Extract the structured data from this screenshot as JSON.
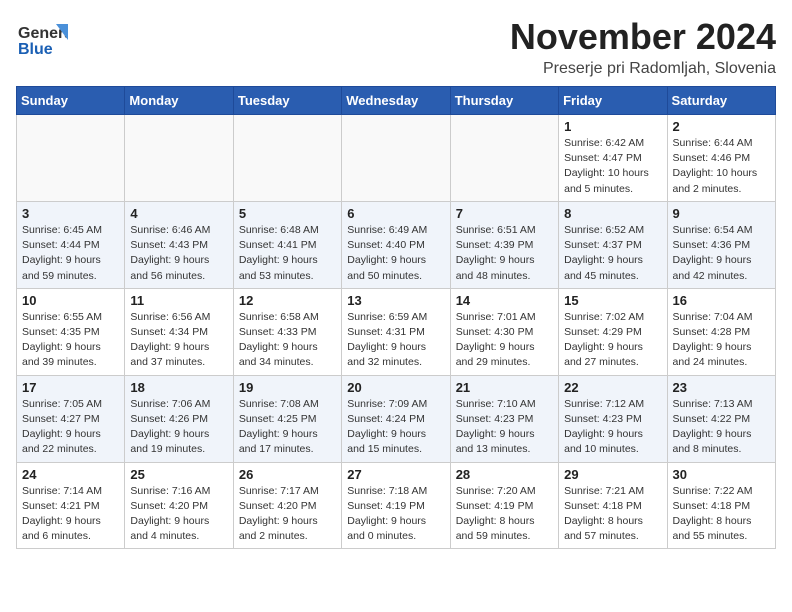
{
  "header": {
    "logo_general": "General",
    "logo_blue": "Blue",
    "month_title": "November 2024",
    "subtitle": "Preserje pri Radomljah, Slovenia"
  },
  "weekdays": [
    "Sunday",
    "Monday",
    "Tuesday",
    "Wednesday",
    "Thursday",
    "Friday",
    "Saturday"
  ],
  "weeks": [
    [
      {
        "day": "",
        "info": ""
      },
      {
        "day": "",
        "info": ""
      },
      {
        "day": "",
        "info": ""
      },
      {
        "day": "",
        "info": ""
      },
      {
        "day": "",
        "info": ""
      },
      {
        "day": "1",
        "info": "Sunrise: 6:42 AM\nSunset: 4:47 PM\nDaylight: 10 hours\nand 5 minutes."
      },
      {
        "day": "2",
        "info": "Sunrise: 6:44 AM\nSunset: 4:46 PM\nDaylight: 10 hours\nand 2 minutes."
      }
    ],
    [
      {
        "day": "3",
        "info": "Sunrise: 6:45 AM\nSunset: 4:44 PM\nDaylight: 9 hours\nand 59 minutes."
      },
      {
        "day": "4",
        "info": "Sunrise: 6:46 AM\nSunset: 4:43 PM\nDaylight: 9 hours\nand 56 minutes."
      },
      {
        "day": "5",
        "info": "Sunrise: 6:48 AM\nSunset: 4:41 PM\nDaylight: 9 hours\nand 53 minutes."
      },
      {
        "day": "6",
        "info": "Sunrise: 6:49 AM\nSunset: 4:40 PM\nDaylight: 9 hours\nand 50 minutes."
      },
      {
        "day": "7",
        "info": "Sunrise: 6:51 AM\nSunset: 4:39 PM\nDaylight: 9 hours\nand 48 minutes."
      },
      {
        "day": "8",
        "info": "Sunrise: 6:52 AM\nSunset: 4:37 PM\nDaylight: 9 hours\nand 45 minutes."
      },
      {
        "day": "9",
        "info": "Sunrise: 6:54 AM\nSunset: 4:36 PM\nDaylight: 9 hours\nand 42 minutes."
      }
    ],
    [
      {
        "day": "10",
        "info": "Sunrise: 6:55 AM\nSunset: 4:35 PM\nDaylight: 9 hours\nand 39 minutes."
      },
      {
        "day": "11",
        "info": "Sunrise: 6:56 AM\nSunset: 4:34 PM\nDaylight: 9 hours\nand 37 minutes."
      },
      {
        "day": "12",
        "info": "Sunrise: 6:58 AM\nSunset: 4:33 PM\nDaylight: 9 hours\nand 34 minutes."
      },
      {
        "day": "13",
        "info": "Sunrise: 6:59 AM\nSunset: 4:31 PM\nDaylight: 9 hours\nand 32 minutes."
      },
      {
        "day": "14",
        "info": "Sunrise: 7:01 AM\nSunset: 4:30 PM\nDaylight: 9 hours\nand 29 minutes."
      },
      {
        "day": "15",
        "info": "Sunrise: 7:02 AM\nSunset: 4:29 PM\nDaylight: 9 hours\nand 27 minutes."
      },
      {
        "day": "16",
        "info": "Sunrise: 7:04 AM\nSunset: 4:28 PM\nDaylight: 9 hours\nand 24 minutes."
      }
    ],
    [
      {
        "day": "17",
        "info": "Sunrise: 7:05 AM\nSunset: 4:27 PM\nDaylight: 9 hours\nand 22 minutes."
      },
      {
        "day": "18",
        "info": "Sunrise: 7:06 AM\nSunset: 4:26 PM\nDaylight: 9 hours\nand 19 minutes."
      },
      {
        "day": "19",
        "info": "Sunrise: 7:08 AM\nSunset: 4:25 PM\nDaylight: 9 hours\nand 17 minutes."
      },
      {
        "day": "20",
        "info": "Sunrise: 7:09 AM\nSunset: 4:24 PM\nDaylight: 9 hours\nand 15 minutes."
      },
      {
        "day": "21",
        "info": "Sunrise: 7:10 AM\nSunset: 4:23 PM\nDaylight: 9 hours\nand 13 minutes."
      },
      {
        "day": "22",
        "info": "Sunrise: 7:12 AM\nSunset: 4:23 PM\nDaylight: 9 hours\nand 10 minutes."
      },
      {
        "day": "23",
        "info": "Sunrise: 7:13 AM\nSunset: 4:22 PM\nDaylight: 9 hours\nand 8 minutes."
      }
    ],
    [
      {
        "day": "24",
        "info": "Sunrise: 7:14 AM\nSunset: 4:21 PM\nDaylight: 9 hours\nand 6 minutes."
      },
      {
        "day": "25",
        "info": "Sunrise: 7:16 AM\nSunset: 4:20 PM\nDaylight: 9 hours\nand 4 minutes."
      },
      {
        "day": "26",
        "info": "Sunrise: 7:17 AM\nSunset: 4:20 PM\nDaylight: 9 hours\nand 2 minutes."
      },
      {
        "day": "27",
        "info": "Sunrise: 7:18 AM\nSunset: 4:19 PM\nDaylight: 9 hours\nand 0 minutes."
      },
      {
        "day": "28",
        "info": "Sunrise: 7:20 AM\nSunset: 4:19 PM\nDaylight: 8 hours\nand 59 minutes."
      },
      {
        "day": "29",
        "info": "Sunrise: 7:21 AM\nSunset: 4:18 PM\nDaylight: 8 hours\nand 57 minutes."
      },
      {
        "day": "30",
        "info": "Sunrise: 7:22 AM\nSunset: 4:18 PM\nDaylight: 8 hours\nand 55 minutes."
      }
    ]
  ]
}
